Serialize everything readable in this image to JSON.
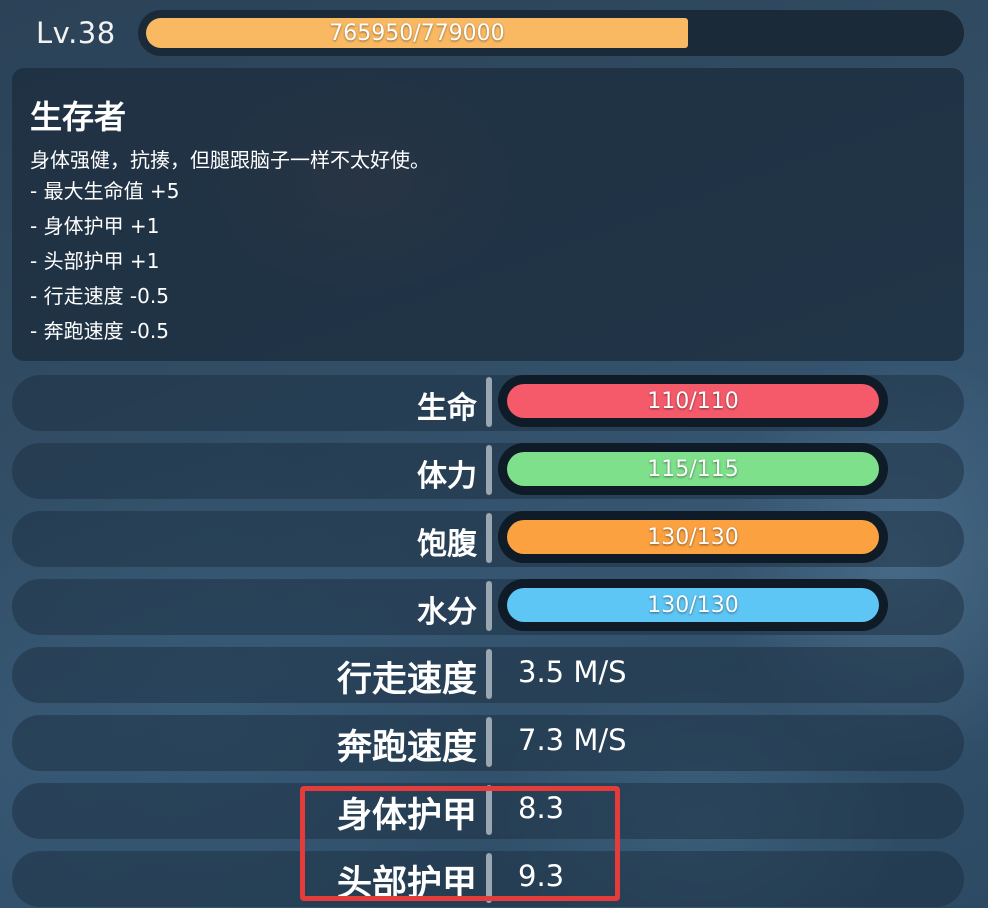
{
  "level": {
    "label": "Lv.38",
    "xp_text": "765950/779000",
    "xp_current": 765950,
    "xp_max": 779000,
    "xp_color": "#f9b862"
  },
  "trait": {
    "name": "生存者",
    "description": "身体强健，抗揍，但腿跟脑子一样不太好使。",
    "effects": [
      "- 最大生命值 +5",
      "- 身体护甲 +1",
      "- 头部护甲 +1",
      "- 行走速度 -0.5",
      "- 奔跑速度 -0.5"
    ]
  },
  "bars": [
    {
      "label": "生命",
      "text": "110/110",
      "current": 110,
      "max": 110,
      "color": "#f55a6a"
    },
    {
      "label": "体力",
      "text": "115/115",
      "current": 115,
      "max": 115,
      "color": "#7ee08b"
    },
    {
      "label": "饱腹",
      "text": "130/130",
      "current": 130,
      "max": 130,
      "color": "#fca140"
    },
    {
      "label": "水分",
      "text": "130/130",
      "current": 130,
      "max": 130,
      "color": "#5ec6f5"
    }
  ],
  "stats": [
    {
      "label": "行走速度",
      "value": "3.5 M/S"
    },
    {
      "label": "奔跑速度",
      "value": "7.3 M/S"
    },
    {
      "label": "身体护甲",
      "value": "8.3"
    },
    {
      "label": "头部护甲",
      "value": "9.3"
    }
  ],
  "highlight": {
    "color": "#e43b3b",
    "target": "armor-stats"
  }
}
